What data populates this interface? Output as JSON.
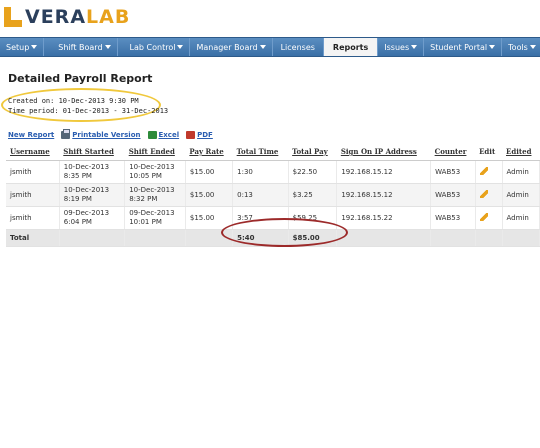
{
  "brand": {
    "part1": "VERA",
    "part2": "LAB"
  },
  "nav": {
    "items": [
      {
        "label": "Setup",
        "dropdown": true,
        "active": false
      },
      {
        "label": "Shift Board",
        "dropdown": true,
        "active": false
      },
      {
        "label": "Lab Control",
        "dropdown": true,
        "active": false
      },
      {
        "label": "Manager Board",
        "dropdown": true,
        "active": false
      },
      {
        "label": "Licenses",
        "dropdown": false,
        "active": false
      },
      {
        "label": "Reports",
        "dropdown": false,
        "active": true
      },
      {
        "label": "Issues",
        "dropdown": true,
        "active": false
      },
      {
        "label": "Student Portal",
        "dropdown": true,
        "active": false
      },
      {
        "label": "Tools",
        "dropdown": true,
        "active": false
      }
    ]
  },
  "report": {
    "title": "Detailed Payroll Report",
    "created": "Created on: 10-Dec-2013 9:30 PM",
    "period": "Time period: 01-Dec-2013 - 31-Dec-2013"
  },
  "toolbar": {
    "new_report": "New Report",
    "printable": "Printable Version",
    "excel": "Excel",
    "pdf": "PDF"
  },
  "table": {
    "headers": {
      "username": "Username",
      "shift_started": "Shift Started",
      "shift_ended": "Shift Ended",
      "pay_rate": "Pay Rate",
      "total_time": "Total Time",
      "total_pay": "Total Pay",
      "ip": "Sign On IP Address",
      "counter": "Counter",
      "edit": "Edit",
      "edited": "Edited"
    },
    "rows": [
      {
        "username": "jsmith",
        "start_date": "10-Dec-2013",
        "start_time": "8:35 PM",
        "end_date": "10-Dec-2013",
        "end_time": "10:05 PM",
        "rate": "$15.00",
        "time": "1:30",
        "pay": "$22.50",
        "ip": "192.168.15.12",
        "counter": "WAB53",
        "edited": "Admin"
      },
      {
        "username": "jsmith",
        "start_date": "10-Dec-2013",
        "start_time": "8:19 PM",
        "end_date": "10-Dec-2013",
        "end_time": "8:32 PM",
        "rate": "$15.00",
        "time": "0:13",
        "pay": "$3.25",
        "ip": "192.168.15.12",
        "counter": "WAB53",
        "edited": "Admin"
      },
      {
        "username": "jsmith",
        "start_date": "09-Dec-2013",
        "start_time": "6:04 PM",
        "end_date": "09-Dec-2013",
        "end_time": "10:01 PM",
        "rate": "$15.00",
        "time": "3:57",
        "pay": "$59.25",
        "ip": "192.168.15.22",
        "counter": "WAB53",
        "edited": "Admin"
      }
    ],
    "total": {
      "label": "Total",
      "time": "5:40",
      "pay": "$85.00"
    }
  },
  "colors": {
    "nav": "#3a6fa6",
    "brand_dark": "#2b3f5c",
    "brand_accent": "#e8a21c",
    "highlight_yellow": "#f0c83c",
    "highlight_red": "#9c2a2a"
  }
}
